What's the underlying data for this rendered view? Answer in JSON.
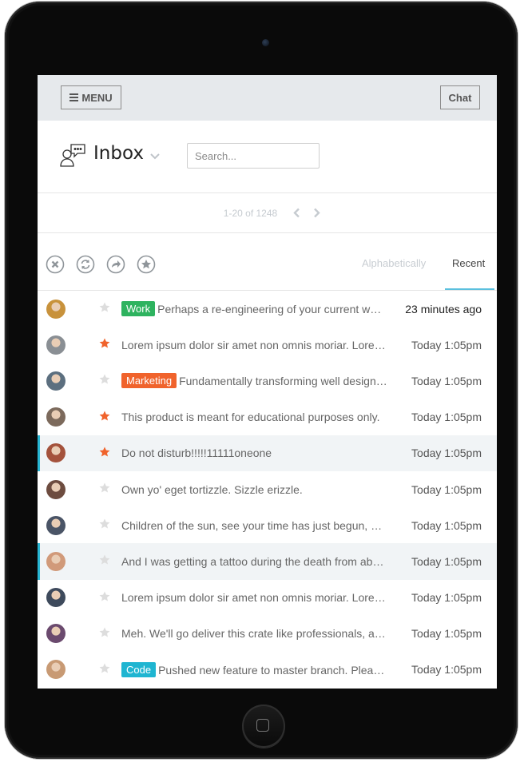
{
  "topbar": {
    "menu_label": "MENU",
    "chat_label": "Chat"
  },
  "inbox": {
    "title": "Inbox",
    "search_placeholder": "Search..."
  },
  "pager": {
    "range": "1-20 of 1248"
  },
  "toolbar": {
    "actions": [
      "close-circle-icon",
      "refresh-icon",
      "forward-icon",
      "star-icon"
    ],
    "sort_options": [
      "Alphabetically",
      "Recent"
    ],
    "active_sort": "Recent"
  },
  "colors": {
    "accent": "#29b6d4",
    "star_active": "#f0632c",
    "star_inactive": "#dddddd",
    "tag_work": "#2eb35f",
    "tag_marketing": "#f0632c",
    "tag_code": "#1fb5d1",
    "highlight_bg": "#f1f4f6"
  },
  "messages": [
    {
      "tag": "Work",
      "tag_color": "#2eb35f",
      "subject": "Perhaps a re-engineering of your current world view will re-energize your online nomenclature.",
      "time": "23 minutes ago",
      "starred": false,
      "highlight": false,
      "avatar_color": "#c8923c"
    },
    {
      "tag": "",
      "tag_color": "",
      "subject": "Lorem ipsum dolor sir amet non omnis moriar. Lorem ipsum dolor sir amet.",
      "time": "Today 1:05pm",
      "starred": true,
      "highlight": false,
      "avatar_color": "#8a8f94"
    },
    {
      "tag": "Marketing",
      "tag_color": "#f0632c",
      "subject": "Fundamentally transforming well designed actionable items.",
      "time": "Today 1:05pm",
      "starred": false,
      "highlight": false,
      "avatar_color": "#5c6f7f"
    },
    {
      "tag": "",
      "tag_color": "",
      "subject": "This product is meant for educational purposes only.",
      "time": "Today 1:05pm",
      "starred": true,
      "highlight": false,
      "avatar_color": "#7c6a5c"
    },
    {
      "tag": "",
      "tag_color": "",
      "subject": "Do not disturb!!!!!11111oneone",
      "time": "Today 1:05pm",
      "starred": true,
      "highlight": true,
      "avatar_color": "#a4523c"
    },
    {
      "tag": "",
      "tag_color": "",
      "subject": "Own yo' eget tortizzle. Sizzle erizzle.",
      "time": "Today 1:05pm",
      "starred": false,
      "highlight": false,
      "avatar_color": "#6d4c3f"
    },
    {
      "tag": "",
      "tag_color": "",
      "subject": "Children of the sun, see your time has just begun, searching for your ways.",
      "time": "Today 1:05pm",
      "starred": false,
      "highlight": false,
      "avatar_color": "#4a5466"
    },
    {
      "tag": "",
      "tag_color": "",
      "subject": "And I was getting a tattoo during the death from above show.",
      "time": "Today 1:05pm",
      "starred": false,
      "highlight": true,
      "avatar_color": "#d19a7a"
    },
    {
      "tag": "",
      "tag_color": "",
      "subject": "Lorem ipsum dolor sir amet non omnis moriar. Lorem ipsum dolor sir amet.",
      "time": "Today 1:05pm",
      "starred": false,
      "highlight": false,
      "avatar_color": "#3e4a5c"
    },
    {
      "tag": "",
      "tag_color": "",
      "subject": "Meh. We'll go deliver this crate like professionals, and then we'll go home.",
      "time": "Today 1:05pm",
      "starred": false,
      "highlight": false,
      "avatar_color": "#6b4a6e"
    },
    {
      "tag": "Code",
      "tag_color": "#1fb5d1",
      "subject": "Pushed new feature to master branch. Please review.",
      "time": "Today 1:05pm",
      "starred": false,
      "highlight": false,
      "avatar_color": "#c89a74"
    }
  ]
}
